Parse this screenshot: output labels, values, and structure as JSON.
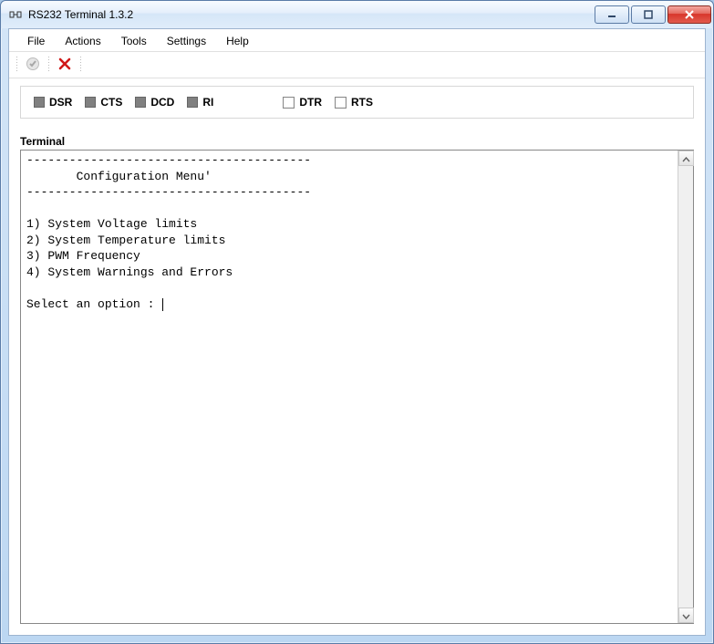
{
  "window": {
    "title": "RS232 Terminal 1.3.2"
  },
  "menu": {
    "file": "File",
    "actions": "Actions",
    "tools": "Tools",
    "settings": "Settings",
    "help": "Help"
  },
  "signals": {
    "dsr": "DSR",
    "cts": "CTS",
    "dcd": "DCD",
    "ri": "RI",
    "dtr": "DTR",
    "rts": "RTS"
  },
  "terminal": {
    "label": "Terminal",
    "content": "----------------------------------------\n       Configuration Menu'\n----------------------------------------\n\n1) System Voltage limits\n2) System Temperature limits\n3) PWM Frequency\n4) System Warnings and Errors\n\nSelect an option : "
  }
}
